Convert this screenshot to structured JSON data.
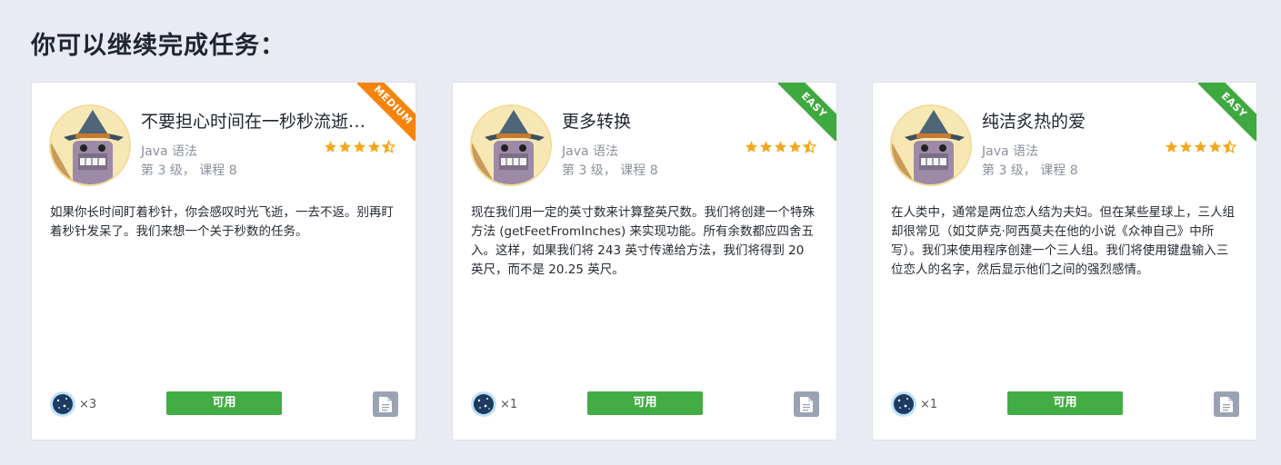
{
  "page": {
    "title": "你可以继续完成任务："
  },
  "colors": {
    "medium": "#f7830b",
    "easy": "#3ea93f",
    "available": "#44ac44",
    "star": "#f5a71b"
  },
  "tasks": [
    {
      "difficulty": "MEDIUM",
      "difficulty_color": "#f7830b",
      "title": "不要担心时间在一秒秒流逝…",
      "subject": "Java 语法",
      "level": "第 3 级， 课程 8",
      "rating": 4.5,
      "description": "如果你长时间盯着秒针，你会感叹时光飞逝，一去不返。别再盯着秒针发呆了。我们来想一个关于秒数的任务。",
      "bonus": "×3",
      "button": "可用",
      "doc_icon": "document-icon"
    },
    {
      "difficulty": "EASY",
      "difficulty_color": "#3ea93f",
      "title": "更多转换",
      "subject": "Java 语法",
      "level": "第 3 级， 课程 8",
      "rating": 4.5,
      "description": "现在我们用一定的英寸数来计算整英尺数。我们将创建一个特殊方法 (getFeetFromInches) 来实现功能。所有余数都应四舍五入。这样，如果我们将 243 英寸传递给方法，我们将得到 20 英尺，而不是 20.25 英尺。",
      "bonus": "×1",
      "button": "可用",
      "doc_icon": "document-icon"
    },
    {
      "difficulty": "EASY",
      "difficulty_color": "#3ea93f",
      "title": "纯洁炙热的爱",
      "subject": "Java 语法",
      "level": "第 3 级， 课程 8",
      "rating": 4.5,
      "description": "在人类中，通常是两位恋人结为夫妇。但在某些星球上，三人组却很常见（如艾萨克·阿西莫夫在他的小说《众神自己》中所写）。我们来使用程序创建一个三人组。我们将使用键盘输入三位恋人的名字，然后显示他们之间的强烈感情。",
      "bonus": "×1",
      "button": "可用",
      "doc_icon": "document-icon"
    }
  ]
}
